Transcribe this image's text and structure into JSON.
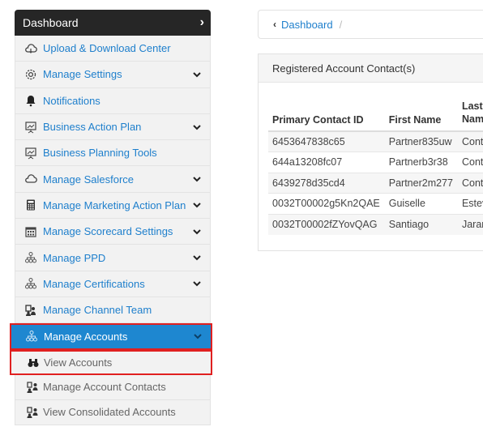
{
  "sidebar": {
    "header": "Dashboard",
    "items": [
      {
        "label": "Upload & Download Center",
        "icon": "cloud-icon",
        "expandable": false
      },
      {
        "label": "Manage Settings",
        "icon": "gear-icon",
        "expandable": true
      },
      {
        "label": "Notifications",
        "icon": "bell-icon",
        "expandable": false
      },
      {
        "label": "Business Action Plan",
        "icon": "presentation-icon",
        "expandable": true
      },
      {
        "label": "Business Planning Tools",
        "icon": "presentation-icon",
        "expandable": false
      },
      {
        "label": "Manage Salesforce",
        "icon": "cloud-icon",
        "expandable": true
      },
      {
        "label": "Manage Marketing Action Plan",
        "icon": "calculator-icon",
        "expandable": true
      },
      {
        "label": "Manage Scorecard Settings",
        "icon": "calendar-icon",
        "expandable": true
      },
      {
        "label": "Manage PPD",
        "icon": "org-chart-icon",
        "expandable": true
      },
      {
        "label": "Manage Certifications",
        "icon": "org-chart-icon",
        "expandable": true
      },
      {
        "label": "Manage Channel Team",
        "icon": "team-icon",
        "expandable": false
      },
      {
        "label": "Manage Accounts",
        "icon": "org-chart-icon",
        "expandable": true
      }
    ],
    "subitems": [
      {
        "label": "View Accounts",
        "icon": "binoculars-icon"
      },
      {
        "label": "Manage Account Contacts",
        "icon": "contacts-icon"
      },
      {
        "label": "View Consolidated Accounts",
        "icon": "contacts-icon"
      }
    ]
  },
  "breadcrumb": {
    "link": "Dashboard",
    "separator": "/"
  },
  "panel": {
    "title": "Registered Account Contact(s)",
    "columns": [
      "Primary Contact ID",
      "First Name",
      "Last Name"
    ],
    "rows": [
      [
        "6453647838c65",
        "Partner835uw",
        "Conta"
      ],
      [
        "644a13208fc07",
        "Partnerb3r38",
        "Conta"
      ],
      [
        "6439278d35cd4",
        "Partner2m277",
        "Conta"
      ],
      [
        "0032T00002g5Kn2QAE",
        "Guiselle",
        "Esteve"
      ],
      [
        "0032T00002fZYovQAG",
        "Santiago",
        "Jaram"
      ]
    ]
  },
  "colors": {
    "accent": "#1e87d0",
    "link": "#1e7fcc",
    "highlight": "#e02020",
    "header_bg": "#262626"
  }
}
